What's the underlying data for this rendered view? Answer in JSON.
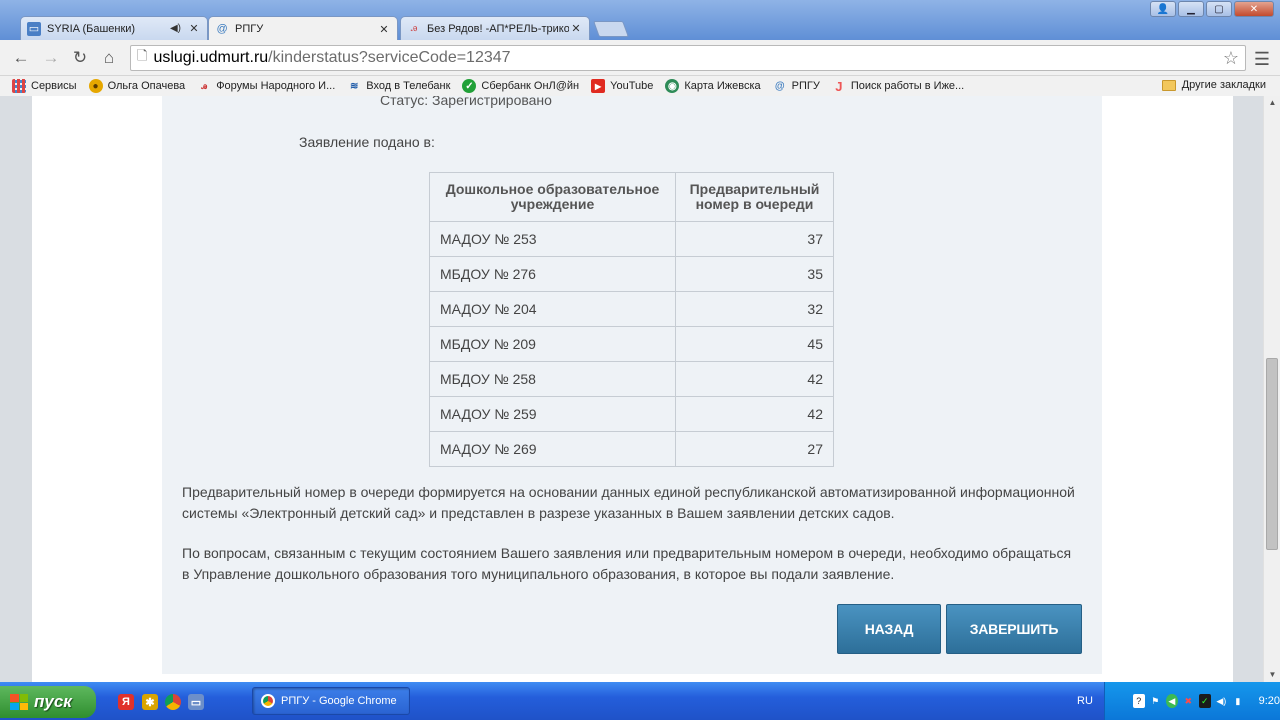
{
  "browser": {
    "tabs": [
      {
        "title": "SYRIA (Башенки)",
        "has_audio": true
      },
      {
        "title": "РПГУ",
        "active": true
      },
      {
        "title": "Без Рядов! -АП*РЕЛЬ-трико"
      }
    ],
    "url": {
      "host": "uslugi.udmurt.ru",
      "path": "/kinderstatus?serviceCode=12347"
    },
    "bookmarks": [
      {
        "label": "Сервисы",
        "icon": "apps-grid-icon"
      },
      {
        "label": "Ольга Опачева",
        "icon": "sunflower-icon"
      },
      {
        "label": "Форумы Народного И...",
        "icon": "people-icon"
      },
      {
        "label": "Вход в Телебанк",
        "icon": "telebank-icon"
      },
      {
        "label": "Сбербанк ОнЛ@йн",
        "icon": "sberbank-icon"
      },
      {
        "label": "YouTube",
        "icon": "youtube-icon"
      },
      {
        "label": "Карта Ижевска",
        "icon": "map-icon"
      },
      {
        "label": "РПГУ",
        "icon": "rpgu-icon"
      },
      {
        "label": "Поиск работы в Иже...",
        "icon": "job-search-icon"
      }
    ],
    "other_bookmarks": "Другие закладки"
  },
  "page": {
    "status_partial": "Статус:   Зарегистрировано",
    "submitted_label": "Заявление подано в:",
    "table": {
      "headers": [
        "Дошкольное образовательное учреждение",
        "Предварительный номер в очереди"
      ],
      "rows": [
        {
          "name": "МАДОУ № 253",
          "queue": "37"
        },
        {
          "name": "МБДОУ № 276",
          "queue": "35"
        },
        {
          "name": "МАДОУ № 204",
          "queue": "32"
        },
        {
          "name": "МБДОУ № 209",
          "queue": "45"
        },
        {
          "name": "МБДОУ № 258",
          "queue": "42"
        },
        {
          "name": "МАДОУ № 259",
          "queue": "42"
        },
        {
          "name": "МАДОУ № 269",
          "queue": "27"
        }
      ]
    },
    "note1_line1": "Предварительный номер в очереди формируется на основании данных единой республиканской автоматизированной информационной",
    "note1_line2": "системы «Электронный детский сад» и представлен в разрезе указанных в Вашем заявлении детских садов.",
    "note2_line1": "По вопросам, связанным с текущим состоянием Вашего заявления или предварительным номером в очереди, необходимо обращаться",
    "note2_line2": "в Управление дошкольного образования того муниципального образования, в которое вы подали заявление.",
    "back_button": "НАЗАД",
    "finish_button": "ЗАВЕРШИТЬ",
    "button_color": "#3a82b0"
  },
  "taskbar": {
    "start_label": "пуск",
    "task_title": "РПГУ - Google Chrome",
    "language": "RU",
    "clock": "9:20"
  }
}
